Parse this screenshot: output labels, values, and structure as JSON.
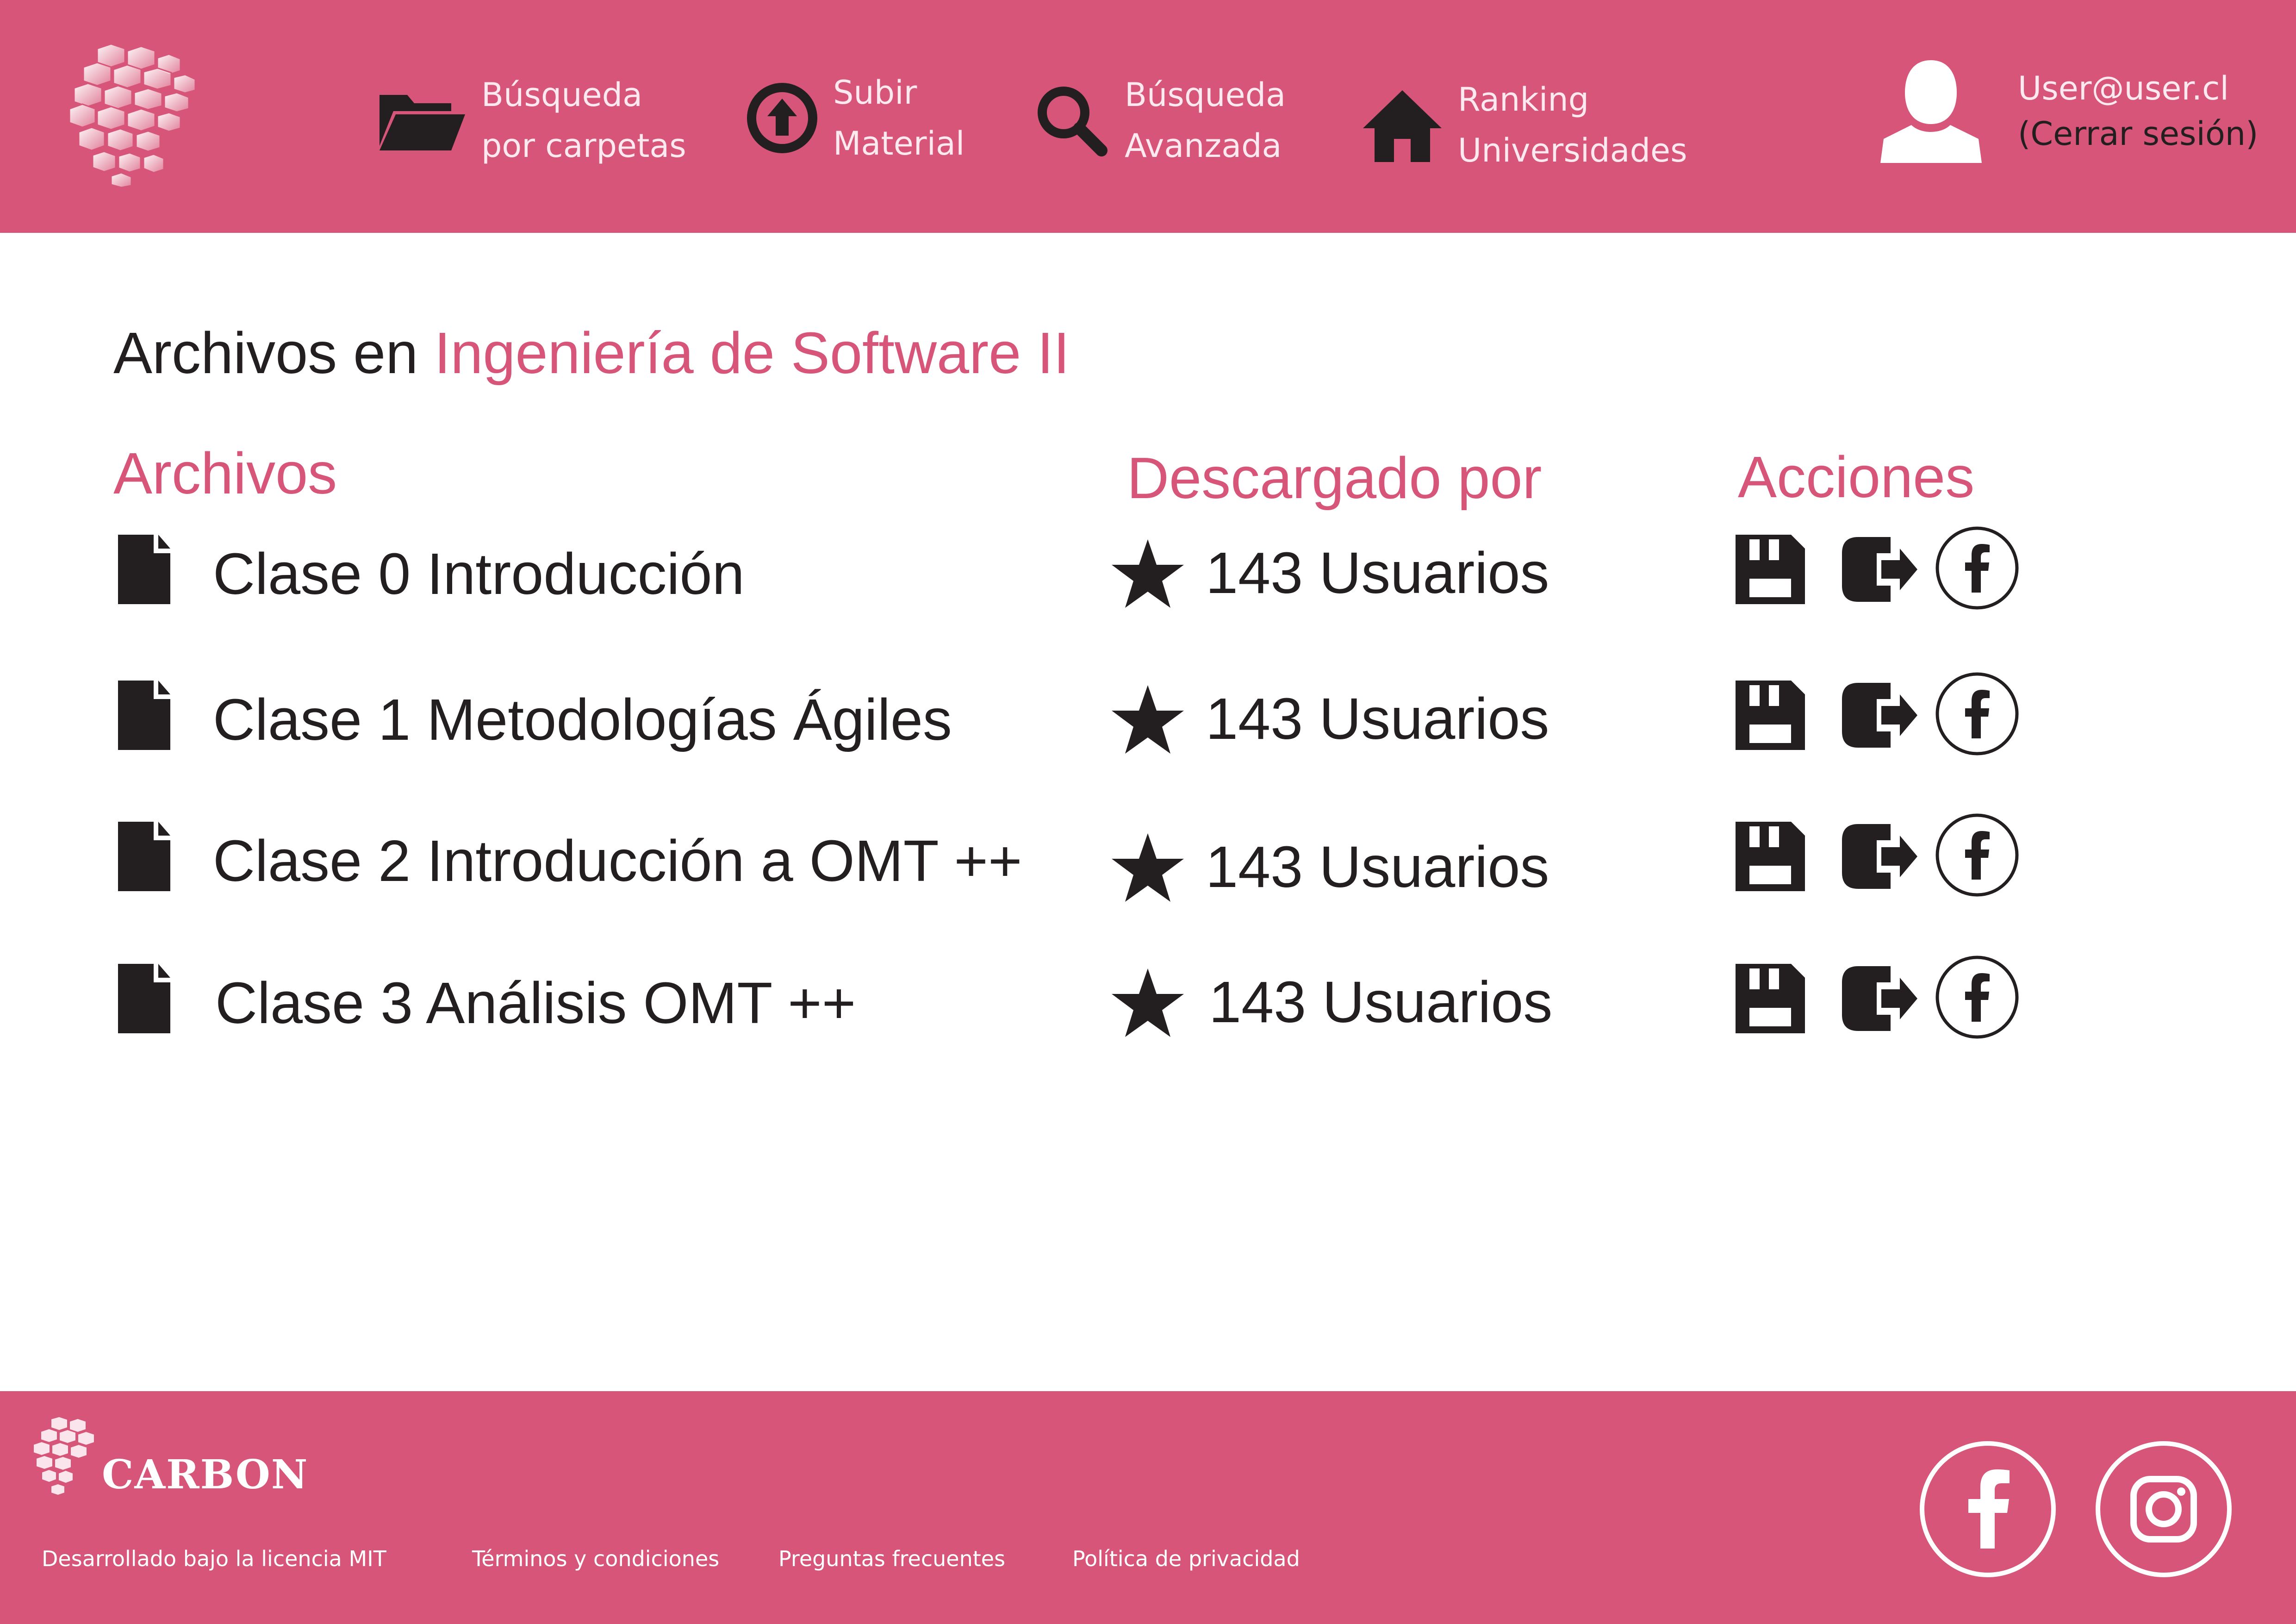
{
  "colors": {
    "brand": "#d75578",
    "text": "#231f20",
    "header_text": "#fde9ef",
    "white": "#ffffff"
  },
  "nav": [
    {
      "icon": "folder-open-icon",
      "line1": "Búsqueda",
      "line2": "por carpetas"
    },
    {
      "icon": "upload-circle-icon",
      "line1": "Subir",
      "line2": "Material"
    },
    {
      "icon": "magnifier-icon",
      "line1": "Búsqueda",
      "line2": "Avanzada"
    },
    {
      "icon": "home-icon",
      "line1": "Ranking",
      "line2": "Universidades"
    }
  ],
  "user": {
    "icon": "user-avatar-icon",
    "email": "User@user.cl",
    "logout": "(Cerrar sesión)"
  },
  "page": {
    "title_prefix": "Archivos en",
    "title_course": "Ingeniería de Software II"
  },
  "columns": {
    "files": "Archivos",
    "downloads": "Descargado por",
    "actions": "Acciones"
  },
  "files": [
    {
      "name": "Clase 0 Introducción",
      "downloads": "143 Usuarios"
    },
    {
      "name": "Clase 1 Metodologías Ágiles",
      "downloads": "143 Usuarios"
    },
    {
      "name": "Clase 2 Introducción a OMT ++",
      "downloads": "143 Usuarios"
    },
    {
      "name": "Clase 3 Análisis OMT ++",
      "downloads": "143 Usuarios"
    }
  ],
  "actions_icons": [
    "save-icon",
    "share-exit-icon",
    "facebook-circle-icon"
  ],
  "footer": {
    "brand": "CARBON",
    "links": [
      "Desarrollado bajo la licencia MIT",
      "Términos y condiciones",
      "Preguntas frecuentes",
      "Política de privacidad"
    ],
    "social": [
      "facebook-icon",
      "instagram-icon"
    ]
  }
}
